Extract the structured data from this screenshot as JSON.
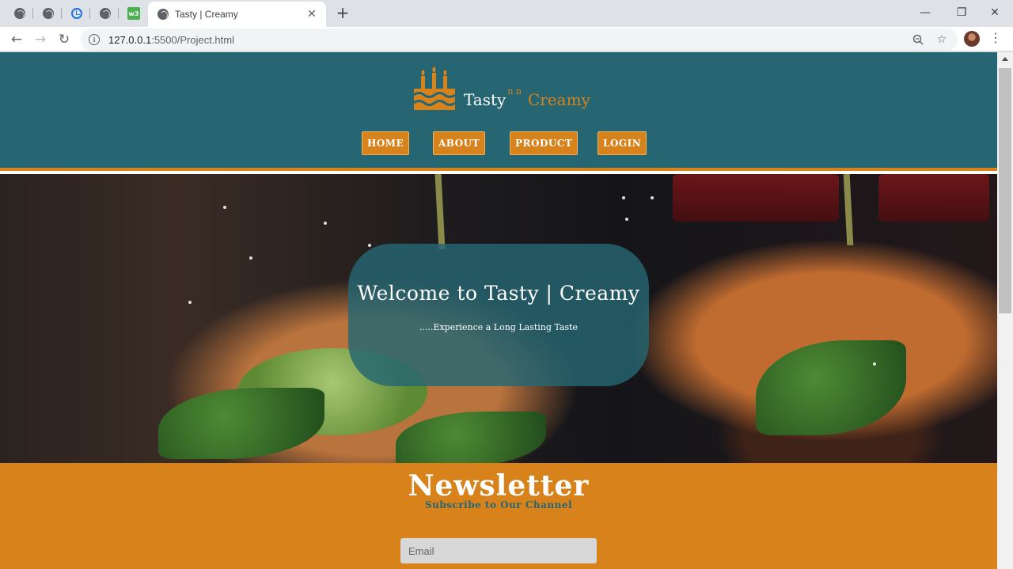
{
  "browser": {
    "active_tab_title": "Tasty | Creamy",
    "pinned_tab_w3": "w3",
    "new_tab": "+",
    "url_host": "127.0.0.1",
    "url_rest": ":5500/Project.html",
    "window_controls": {
      "minimize": "—",
      "restore": "❐",
      "close": "✕"
    },
    "tab_close": "✕"
  },
  "header": {
    "brand_word1": "Tasty",
    "brand_middle": "n n",
    "brand_word2": "Creamy",
    "nav": [
      "HOME",
      "ABOUT",
      "PRODUCT",
      "LOGIN"
    ]
  },
  "hero": {
    "title": "Welcome to Tasty | Creamy",
    "tagline": ".....Experience a Long Lasting Taste"
  },
  "newsletter": {
    "title": "Newsletter",
    "subtitle": "Subscribe to Our Channel",
    "email_placeholder": "Email"
  },
  "colors": {
    "teal": "#266673",
    "orange": "#d8821c"
  }
}
